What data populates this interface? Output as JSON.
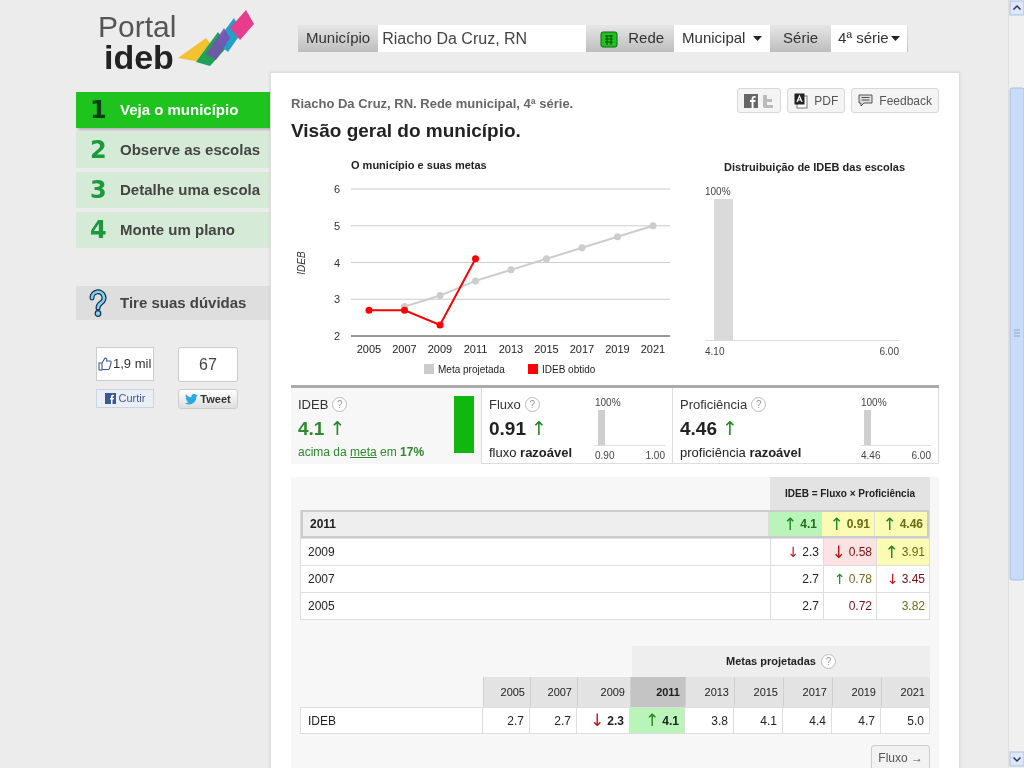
{
  "logo": {
    "line1": "Portal",
    "line2": "ideb"
  },
  "filters": {
    "municipio": {
      "label": "Município",
      "value": "Riacho Da Cruz, RN"
    },
    "rede": {
      "label": "Rede",
      "value": "Municipal"
    },
    "serie": {
      "label": "Série",
      "value": "4ª série"
    }
  },
  "nav": [
    {
      "number": "1",
      "label": "Veja o município",
      "selected": true
    },
    {
      "number": "2",
      "label": "Observe as escolas",
      "selected": false
    },
    {
      "number": "3",
      "label": "Detalhe uma escola",
      "selected": false
    },
    {
      "number": "4",
      "label": "Monte um plano",
      "selected": false
    }
  ],
  "help": {
    "label": "Tire suas dúvidas"
  },
  "social": {
    "like_count": "1,9 mil",
    "like_button": "Curtir",
    "tweet_count": "67",
    "tweet_button": "Tweet"
  },
  "header": {
    "subtitle": "Riacho Da Cruz, RN. Rede municipal, 4ª série.",
    "title": "Visão geral do município.",
    "actions": [
      {
        "kind": "share"
      },
      {
        "kind": "pdf",
        "label": "PDF"
      },
      {
        "kind": "feedback",
        "label": "Feedback"
      }
    ]
  },
  "line_chart": {
    "chart_data": {
      "type": "line",
      "title": "O município e suas metas",
      "ylabel": "IDEB",
      "grid": true,
      "legend": true,
      "categories": [
        "2005",
        "2007",
        "2009",
        "2011",
        "2013",
        "2015",
        "2017",
        "2019",
        "2021"
      ],
      "ylim": [
        2,
        6
      ],
      "yticks": [
        2,
        3,
        4,
        5,
        6
      ],
      "series": [
        {
          "name": "Meta projetada",
          "color": "#cccccc",
          "marker": "circle",
          "values": [
            null,
            2.8,
            3.1,
            3.5,
            3.8,
            4.1,
            4.4,
            4.7,
            5.0
          ]
        },
        {
          "name": "IDEB obtido",
          "color": "#ff0000",
          "marker": "circle",
          "values": [
            2.7,
            2.7,
            2.3,
            4.1,
            null,
            null,
            null,
            null,
            null
          ]
        }
      ]
    }
  },
  "distribution": {
    "title": "Distruibuição de IDEB das escolas",
    "bar_label": "100%",
    "min_label": "4.10",
    "max_label": "6.00"
  },
  "summary": [
    {
      "kind": "ideb",
      "label": "IDEB",
      "help": "?",
      "value": "4.1",
      "arrow": "↑",
      "note_prefix": "acima da",
      "link": "meta",
      "note_suffix": "em **17%**",
      "selected": true
    },
    {
      "kind": "fluxo",
      "label": "Fluxo",
      "help": "?",
      "value": "0.91",
      "arrow": "↑",
      "note": "fluxo **razoável**",
      "bar_label": "100%",
      "min_label": "0.90",
      "max_label": "1.00",
      "selected": false
    },
    {
      "kind": "proficiencia",
      "label": "Proficiência",
      "help": "?",
      "value": "4.46",
      "arrow": "↑",
      "note": "proficiência **razoável**",
      "bar_label": "100%",
      "min_label": "4.46",
      "max_label": "6.00",
      "selected": false
    }
  ],
  "history": {
    "header": "IDEB = Fluxo × Proficiência",
    "rows": [
      {
        "year": "2011",
        "selected": true,
        "cells": [
          {
            "arrow": "↑",
            "rising": true,
            "value": "4.1",
            "color": "#1f6e1f",
            "highlight": true
          },
          {
            "arrow": "↑",
            "rising": true,
            "value": "0.91",
            "color": "#6b6b14",
            "highlight": true
          },
          {
            "arrow": "↑",
            "rising": true,
            "value": "4.46",
            "color": "#6b6b14",
            "highlight": true
          }
        ]
      },
      {
        "year": "2009",
        "selected": false,
        "cells": [
          {
            "arrow": "↓",
            "rising": false,
            "value": "2.3",
            "color": "#222222",
            "highlight": false
          },
          {
            "arrow": "↓",
            "rising": false,
            "value": "0.58",
            "color": "#7a0e0e",
            "highlight": true
          },
          {
            "arrow": "↑",
            "rising": true,
            "value": "3.91",
            "color": "#6b6b14",
            "highlight": true
          }
        ]
      },
      {
        "year": "2007",
        "selected": false,
        "cells": [
          {
            "value": "2.7",
            "color": "#222222",
            "highlight": false
          },
          {
            "arrow": "↑",
            "rising": true,
            "value": "0.78",
            "color": "#6b6b14",
            "highlight": false
          },
          {
            "arrow": "↓",
            "rising": false,
            "value": "3.45",
            "color": "#7a0e0e",
            "highlight": false
          }
        ]
      },
      {
        "year": "2005",
        "selected": false,
        "cells": [
          {
            "value": "2.7",
            "color": "#222222",
            "highlight": false
          },
          {
            "value": "0.72",
            "color": "#7a0e0e",
            "highlight": false
          },
          {
            "value": "3.82",
            "color": "#6b6b14",
            "highlight": false
          }
        ]
      }
    ]
  },
  "metas": {
    "header": "Metas projetadas",
    "help": "?",
    "years": [
      {
        "year": "2005",
        "selected": false
      },
      {
        "year": "2007",
        "selected": false
      },
      {
        "year": "2009",
        "selected": false
      },
      {
        "year": "2011",
        "selected": true
      },
      {
        "year": "2013",
        "selected": false
      },
      {
        "year": "2015",
        "selected": false
      },
      {
        "year": "2017",
        "selected": false
      },
      {
        "year": "2019",
        "selected": false
      },
      {
        "year": "2021",
        "selected": false
      }
    ],
    "row": {
      "label": "IDEB",
      "cells": [
        {
          "value": "2.7",
          "highlight": false
        },
        {
          "value": "2.7",
          "highlight": false
        },
        {
          "arrow": "↓",
          "rising": false,
          "value": "2.3",
          "highlight": false
        },
        {
          "arrow": "↑",
          "rising": true,
          "value": "4.1",
          "highlight": true
        },
        {
          "value": "3.8",
          "highlight": false
        },
        {
          "value": "4.1",
          "highlight": false
        },
        {
          "value": "4.4",
          "highlight": false
        },
        {
          "value": "4.7",
          "highlight": false
        },
        {
          "value": "5.0",
          "highlight": false
        }
      ]
    }
  },
  "next_button": "Fluxo →"
}
